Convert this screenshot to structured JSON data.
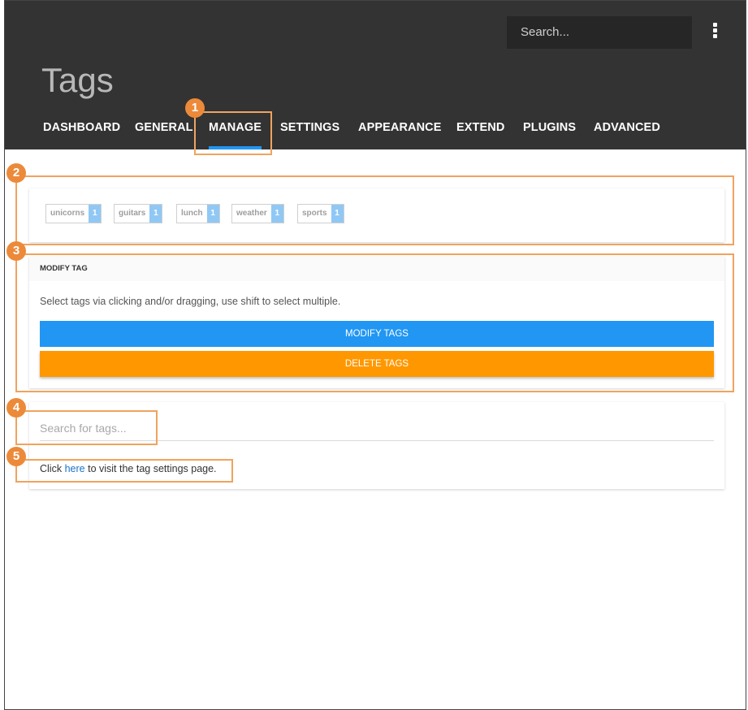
{
  "header": {
    "search_placeholder": "Search...",
    "page_title": "Tags",
    "menu_icon": "kebab-menu-icon"
  },
  "nav": {
    "tabs": [
      {
        "label": "DASHBOARD"
      },
      {
        "label": "GENERAL"
      },
      {
        "label": "MANAGE",
        "active": true
      },
      {
        "label": "SETTINGS"
      },
      {
        "label": "APPEARANCE"
      },
      {
        "label": "EXTEND"
      },
      {
        "label": "PLUGINS"
      },
      {
        "label": "ADVANCED"
      }
    ]
  },
  "tags": [
    {
      "name": "unicorns",
      "count": "1"
    },
    {
      "name": "guitars",
      "count": "1"
    },
    {
      "name": "lunch",
      "count": "1"
    },
    {
      "name": "weather",
      "count": "1"
    },
    {
      "name": "sports",
      "count": "1"
    }
  ],
  "modify": {
    "title": "MODIFY TAG",
    "description": "Select tags via clicking and/or dragging, use shift to select multiple.",
    "modify_button": "MODIFY TAGS",
    "delete_button": "DELETE TAGS"
  },
  "search": {
    "placeholder": "Search for tags..."
  },
  "settings_link": {
    "prefix": "Click",
    "link_text": "here",
    "suffix": "to visit the tag settings page."
  },
  "callouts": {
    "c1": "1",
    "c2": "2",
    "c3": "3",
    "c4": "4",
    "c5": "5"
  },
  "colors": {
    "header_bg": "#333333",
    "accent_blue": "#2196f3",
    "accent_orange": "#ff9800",
    "callout": "#ec8a3a"
  }
}
